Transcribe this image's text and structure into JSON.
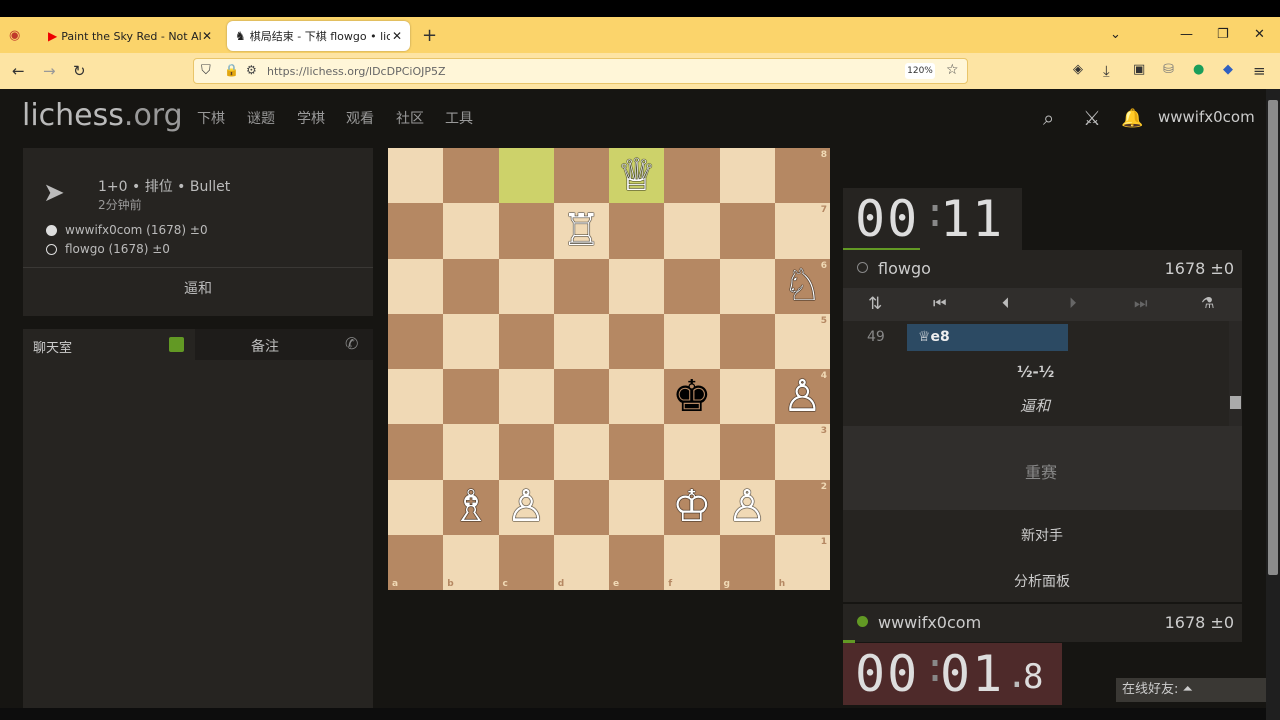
{
  "browser": {
    "tabs": [
      {
        "label": "Paint the Sky Red - Not All Who",
        "icon": "youtube-icon"
      },
      {
        "label": "棋局结束 - 下棋 flowgo • liches",
        "icon": "lichess-icon"
      }
    ],
    "new_tab": "+",
    "url": "https://lichess.org/lDcDPCiOJP5Z",
    "zoom": "120%"
  },
  "site": {
    "logo_main": "lichess",
    "logo_tld": ".org",
    "nav": [
      "下棋",
      "谜题",
      "学棋",
      "观看",
      "社区",
      "工具"
    ],
    "username": "wwwifx0com"
  },
  "game_info": {
    "mode": "1+0 • 排位 • Bullet",
    "time_ago": "2分钟前",
    "white_player": "wwwifx0com (1678) ±0",
    "black_player": "flowgo (1678) ±0",
    "result": "逼和"
  },
  "chat": {
    "tab_chat": "聊天室",
    "tab_notes": "备注"
  },
  "board": {
    "files": [
      "a",
      "b",
      "c",
      "d",
      "e",
      "f",
      "g",
      "h"
    ],
    "ranks": [
      "8",
      "7",
      "6",
      "5",
      "4",
      "3",
      "2",
      "1"
    ],
    "pieces": [
      {
        "sq": "e8",
        "glyph": "♕",
        "color": "white"
      },
      {
        "sq": "d7",
        "glyph": "♖",
        "color": "white"
      },
      {
        "sq": "h6",
        "glyph": "♘",
        "color": "white"
      },
      {
        "sq": "f4",
        "glyph": "♚",
        "color": "black"
      },
      {
        "sq": "h4",
        "glyph": "♙",
        "color": "white"
      },
      {
        "sq": "b2",
        "glyph": "♗",
        "color": "white"
      },
      {
        "sq": "c2",
        "glyph": "♙",
        "color": "white"
      },
      {
        "sq": "f2",
        "glyph": "♔",
        "color": "white"
      },
      {
        "sq": "g2",
        "glyph": "♙",
        "color": "white"
      }
    ],
    "highlights": [
      "c8",
      "e8"
    ]
  },
  "clocks": {
    "top": {
      "mm": "00",
      "ss": "11"
    },
    "bottom": {
      "mm": "00",
      "ss": "01",
      "tenths": "8"
    }
  },
  "players": {
    "top": {
      "name": "flowgo",
      "rating": "1678 ±0"
    },
    "bottom": {
      "name": "wwwifx0com",
      "rating": "1678 ±0"
    }
  },
  "moves": {
    "number": "49",
    "san": "♕e8",
    "score": "½-½",
    "status": "逼和"
  },
  "buttons": {
    "rematch": "重赛",
    "new_opponent": "新对手",
    "analysis": "分析面板"
  },
  "friends": "在线好友:"
}
